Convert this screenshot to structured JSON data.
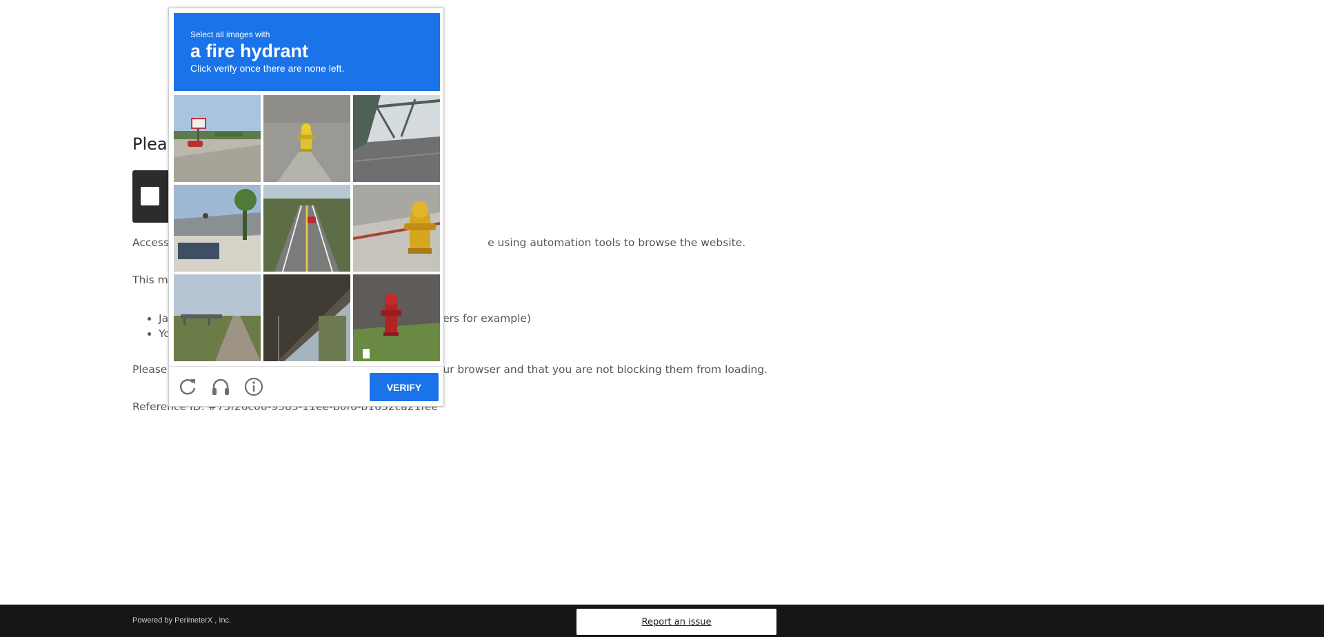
{
  "page": {
    "heading": "Pleas",
    "paragraph_access_left": "Access",
    "paragraph_access_right": "e using automation tools to browse the website.",
    "paragraph_may": "This ma",
    "list_items": [
      {
        "left": "Ja",
        "right": "ers for example)"
      },
      {
        "left": "Yo",
        "right": ""
      }
    ],
    "paragraph_please_left": "Please",
    "paragraph_please_right": "ur browser and that you are not blocking them from loading.",
    "reference_text": "Reference ID: #75f26c00-9585-11ee-b0f6-b1652ca21fee"
  },
  "captcha": {
    "instruction": "Select all images with",
    "target": "a fire hydrant",
    "subinstruction": "Click verify once there are none left.",
    "tiles": [
      {
        "scene": "sign-and-car"
      },
      {
        "scene": "yellow-hydrant"
      },
      {
        "scene": "bridge"
      },
      {
        "scene": "gas-station"
      },
      {
        "scene": "road-with-car"
      },
      {
        "scene": "yellow-hydrant-closeup"
      },
      {
        "scene": "dirt-road"
      },
      {
        "scene": "overpass"
      },
      {
        "scene": "red-hydrant"
      }
    ],
    "icons": {
      "reload": "reload-icon",
      "audio": "headphones-icon",
      "info": "info-icon"
    },
    "verify_label": "VERIFY",
    "accent_color": "#1a73e8"
  },
  "footer": {
    "powered_by": "Powered by PerimeterX , Inc.",
    "report_label": "Report an issue"
  }
}
